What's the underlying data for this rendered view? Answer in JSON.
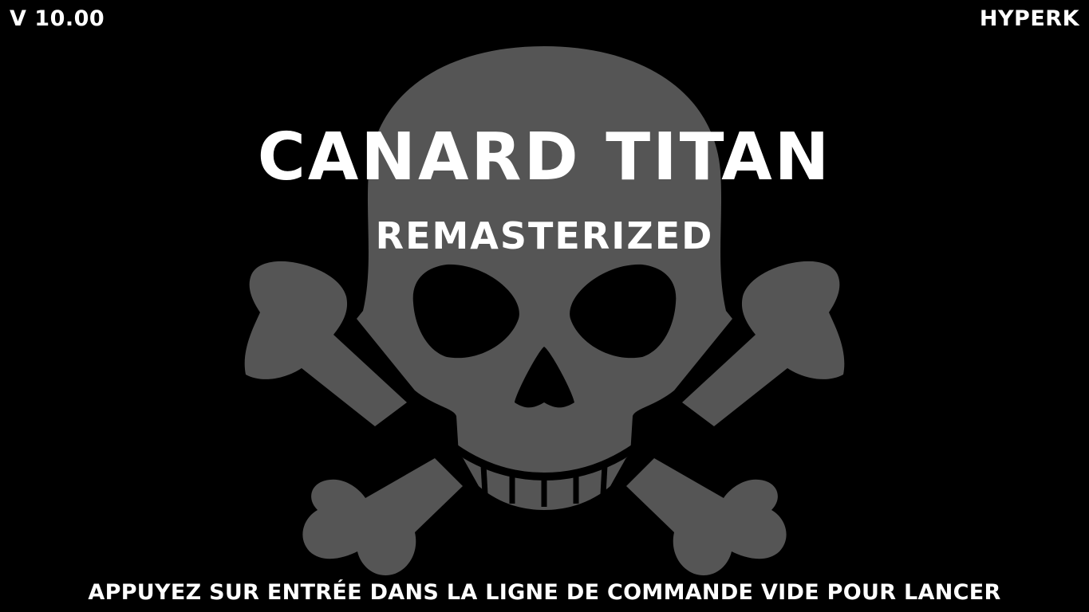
{
  "hud": {
    "version": "V 10.00",
    "author": "HYPERK"
  },
  "title_screen": {
    "title": "CANARD TITAN",
    "subtitle": "REMASTERIZED",
    "prompt": "APPUYEZ SUR ENTRÉE DANS LA LIGNE DE COMMANDE VIDE POUR LANCER"
  },
  "background": {
    "icon": "skull-and-crossbones-icon",
    "color": "#555555",
    "backdrop": "#000000"
  }
}
